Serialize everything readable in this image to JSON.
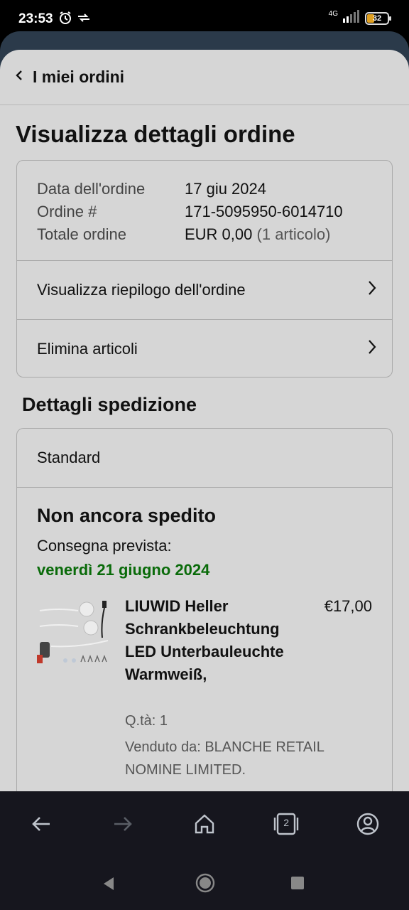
{
  "status_bar": {
    "time": "23:53",
    "network": "4G",
    "battery": "32",
    "icons": [
      "alarm-icon",
      "data-sync-icon",
      "signal-icon",
      "battery-icon"
    ]
  },
  "nav": {
    "back_label": "I miei ordini"
  },
  "page": {
    "title": "Visualizza dettagli ordine"
  },
  "order": {
    "date_label": "Data dell'ordine",
    "date_value": "17 giu 2024",
    "number_label": "Ordine #",
    "number_value": "171-5095950-6014710",
    "total_label": "Totale ordine",
    "total_value": "EUR 0,00",
    "total_items": "(1 articolo)",
    "summary_link": "Visualizza riepilogo dell'ordine",
    "delete_link": "Elimina articoli"
  },
  "shipping": {
    "section_title": "Dettagli spedizione",
    "method": "Standard",
    "status": "Non ancora spedito",
    "expected_label": "Consegna prevista:",
    "expected_date": "venerdì 21 giugno 2024",
    "date_color": "#0a6b0a"
  },
  "item": {
    "title": "LIUWID Heller Schrankbeleuchtung LED Unterbauleuchte Warmweiß,",
    "price": "€17,00",
    "quantity": "Q.tà: 1",
    "seller": "Venduto da: BLANCHE RETAIL NOMINE LIMITED."
  },
  "browser_bar": {
    "tabs_count": "2",
    "icons": [
      "back-arrow-icon",
      "forward-arrow-icon",
      "home-icon",
      "tabs-icon",
      "account-icon"
    ]
  }
}
